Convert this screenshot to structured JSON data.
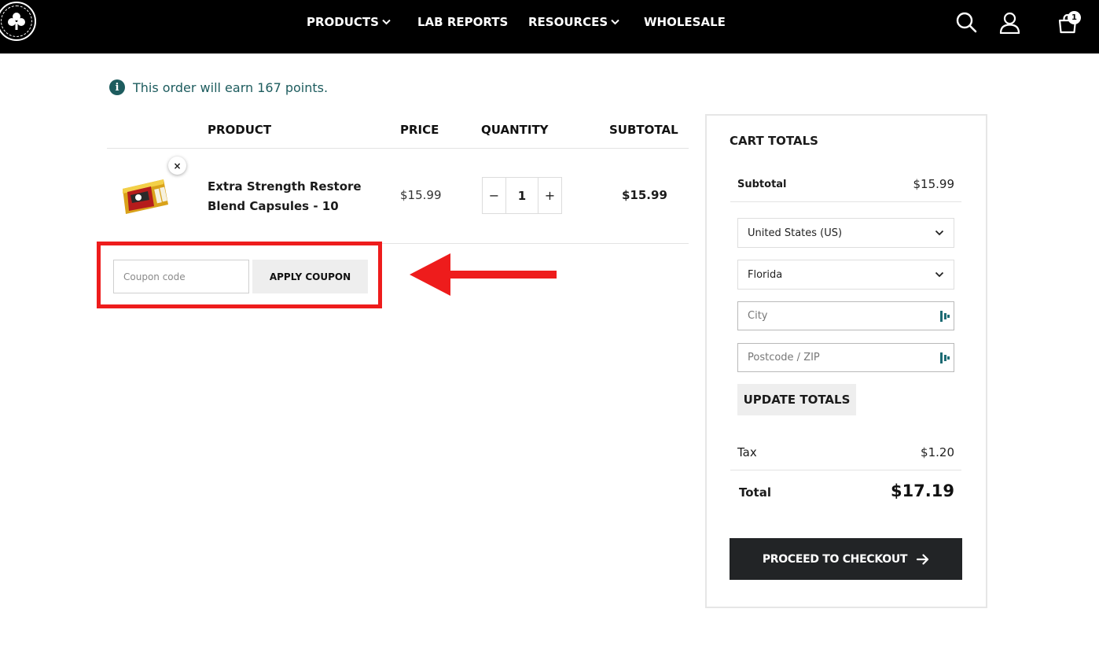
{
  "nav": {
    "products": "PRODUCTS",
    "lab_reports": "LAB REPORTS",
    "resources": "RESOURCES",
    "wholesale": "WHOLESALE",
    "cart_count": "1"
  },
  "notice": {
    "text": "This order will earn 167 points."
  },
  "table": {
    "headers": {
      "product": "PRODUCT",
      "price": "PRICE",
      "quantity": "QUANTITY",
      "subtotal": "SUBTOTAL"
    },
    "items": [
      {
        "name": "Extra Strength Restore Blend Capsules - 10",
        "price": "$15.99",
        "quantity": "1",
        "subtotal": "$15.99",
        "qty_minus": "−",
        "qty_plus": "+",
        "remove": "×"
      }
    ]
  },
  "coupon": {
    "placeholder": "Coupon code",
    "apply_label": "APPLY COUPON"
  },
  "totals": {
    "title": "CART TOTALS",
    "subtotal_label": "Subtotal",
    "subtotal_value": "$15.99",
    "country": "United States (US)",
    "state": "Florida",
    "city_placeholder": "City",
    "zip_placeholder": "Postcode / ZIP",
    "update_label": "UPDATE TOTALS",
    "tax_label": "Tax",
    "tax_value": "$1.20",
    "total_label": "Total",
    "total_value": "$17.19",
    "checkout_label": "PROCEED TO CHECKOUT"
  },
  "colors": {
    "header_bg": "#000000",
    "notice_teal": "#1d5c5e",
    "highlight_red": "#ee1c1c",
    "checkout_bg": "#222426"
  },
  "icons": [
    "club-logo-icon",
    "chevron-down-icon",
    "search-icon",
    "user-icon",
    "cart-icon",
    "info-icon",
    "close-icon",
    "arrow-right-icon",
    "red-arrow-icon"
  ]
}
